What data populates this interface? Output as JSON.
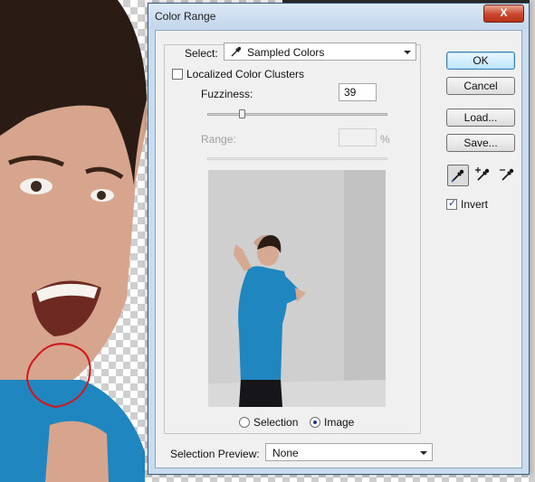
{
  "dialog": {
    "title": "Color Range",
    "close_label": "X",
    "select_label": "Select:",
    "select_value": "Sampled Colors",
    "localized_label": "Localized Color Clusters",
    "localized_checked": false,
    "fuzziness_label": "Fuzziness:",
    "fuzziness_value": "39",
    "range_label": "Range:",
    "range_unit": "%",
    "range_value": "",
    "radio_selection_label": "Selection",
    "radio_image_label": "Image",
    "selected_view": "Image",
    "selection_preview_label": "Selection Preview:",
    "selection_preview_value": "None",
    "buttons": {
      "ok": "OK",
      "cancel": "Cancel",
      "load": "Load...",
      "save": "Save..."
    },
    "invert_label": "Invert",
    "invert_checked": true,
    "tools": [
      "eyedropper-icon",
      "eyedropper-plus-icon",
      "eyedropper-minus-icon"
    ],
    "active_tool": "eyedropper-icon"
  },
  "colors": {
    "dialog_frame": "#c9dcef",
    "close_button": "#c9462c",
    "shirt_blue": "#1f86c0"
  }
}
